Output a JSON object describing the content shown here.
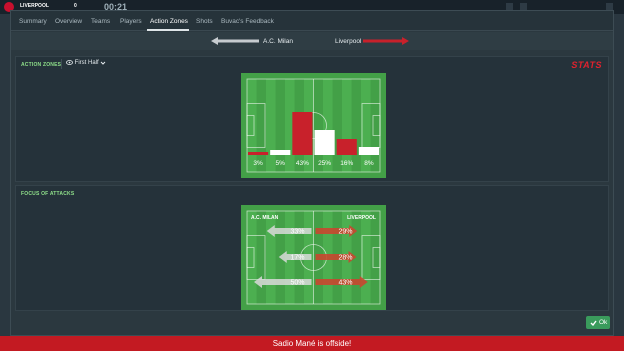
{
  "background": {
    "team_name": "LIVERPOOL",
    "score": "0",
    "clock": "00:21"
  },
  "tabs": [
    {
      "label": "Summary",
      "active": false
    },
    {
      "label": "Overview",
      "active": false
    },
    {
      "label": "Teams",
      "active": false
    },
    {
      "label": "Players",
      "active": false
    },
    {
      "label": "Action Zones",
      "active": true
    },
    {
      "label": "Shots",
      "active": false
    },
    {
      "label": "Buvac's Feedback",
      "active": false
    }
  ],
  "match": {
    "home": "A.C. Milan",
    "away": "Liverpool"
  },
  "action_zones": {
    "title": "ACTION ZONES",
    "period": "First Half",
    "brand": "STATS",
    "chart_data": {
      "type": "bar",
      "categories": [
        "Zone 1",
        "Zone 2",
        "Zone 3",
        "Zone 4",
        "Zone 5",
        "Zone 6"
      ],
      "values": [
        3,
        5,
        43,
        25,
        16,
        8
      ],
      "labels": [
        "3%",
        "5%",
        "43%",
        "25%",
        "16%",
        "8%"
      ],
      "bar_colors": [
        "#c8212b",
        "#ffffff",
        "#c8212b",
        "#ffffff",
        "#c8212b",
        "#ffffff"
      ],
      "ylim": [
        0,
        50
      ]
    }
  },
  "focus_of_attacks": {
    "title": "FOCUS OF ATTACKS",
    "home_label": "A.C. MILAN",
    "away_label": "LIVERPOOL",
    "chart_data": {
      "type": "bar",
      "categories": [
        "Left",
        "Centre",
        "Right"
      ],
      "series": [
        {
          "name": "A.C. MILAN",
          "values": [
            33,
            17,
            50
          ],
          "labels": [
            "33%",
            "17%",
            "50%"
          ],
          "color": "#d9d9d9"
        },
        {
          "name": "LIVERPOOL",
          "values": [
            29,
            28,
            43
          ],
          "labels": [
            "29%",
            "28%",
            "43%"
          ],
          "color": "#c9472f"
        }
      ]
    }
  },
  "ok_button": {
    "label": "Ok"
  },
  "notification": {
    "text": "Sadio Mané is offside!"
  },
  "colors": {
    "pitch_light": "#4caf50",
    "pitch_dark": "#43a047",
    "liverpool_red": "#c8212b",
    "milan_grey": "#d9d9d9",
    "accent_green": "#8fe08a",
    "banner_red": "#c31a22"
  }
}
